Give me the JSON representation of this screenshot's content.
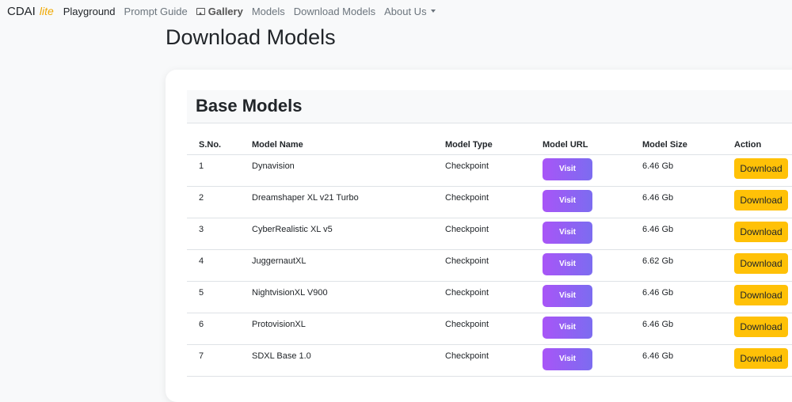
{
  "navbar": {
    "brand": "CDAI",
    "brand_suffix": "lite",
    "items": [
      {
        "label": "Playground"
      },
      {
        "label": "Prompt Guide"
      },
      {
        "label": "Gallery"
      },
      {
        "label": "Models"
      },
      {
        "label": "Download Models"
      },
      {
        "label": "About Us"
      }
    ]
  },
  "page_title": "Download Models",
  "section": {
    "title": "Base Models",
    "columns": [
      "S.No.",
      "Model Name",
      "Model Type",
      "Model URL",
      "Model Size",
      "Action"
    ],
    "visit_label": "Visit",
    "download_label": "Download",
    "rows": [
      {
        "sno": "1",
        "name": "Dynavision",
        "type": "Checkpoint",
        "size": "6.46 Gb"
      },
      {
        "sno": "2",
        "name": "Dreamshaper XL v21 Turbo",
        "type": "Checkpoint",
        "size": "6.46 Gb"
      },
      {
        "sno": "3",
        "name": "CyberRealistic XL v5",
        "type": "Checkpoint",
        "size": "6.46 Gb"
      },
      {
        "sno": "4",
        "name": "JuggernautXL",
        "type": "Checkpoint",
        "size": "6.62 Gb"
      },
      {
        "sno": "5",
        "name": "NightvisionXL V900",
        "type": "Checkpoint",
        "size": "6.46 Gb"
      },
      {
        "sno": "6",
        "name": "ProtovisionXL",
        "type": "Checkpoint",
        "size": "6.46 Gb"
      },
      {
        "sno": "7",
        "name": "SDXL Base 1.0",
        "type": "Checkpoint",
        "size": "6.46 Gb"
      }
    ]
  },
  "colors": {
    "accent_yellow": "#ffc107",
    "visit_gradient_start": "#a855f7",
    "visit_gradient_end": "#7c6cf0",
    "brand_lite": "#f0a800"
  }
}
